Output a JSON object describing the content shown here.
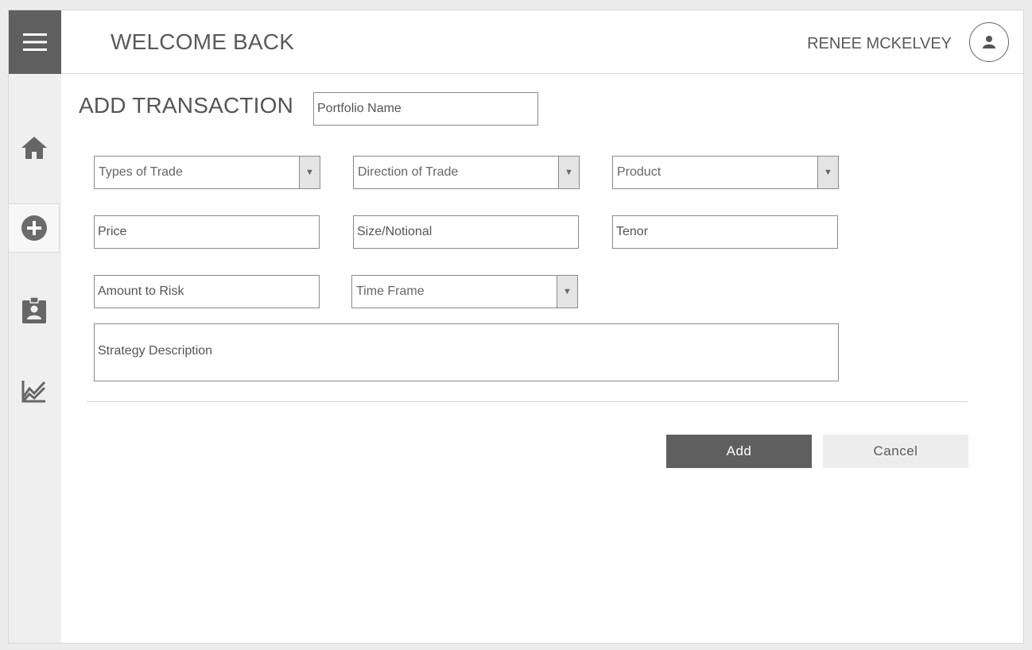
{
  "header": {
    "welcome": "WELCOME BACK",
    "username": "RENEE MCKELVEY"
  },
  "icons": {
    "menu": "hamburger-icon",
    "avatar": "user-icon",
    "nav": [
      "home-icon",
      "add-circle-icon",
      "badge-icon",
      "chart-icon"
    ]
  },
  "page": {
    "title": "ADD TRANSACTION",
    "portfolio_placeholder": "Portfolio Name"
  },
  "form": {
    "types_of_trade": "Types of Trade",
    "direction_of_trade": "Direction of Trade",
    "product": "Product",
    "price_placeholder": "Price",
    "size_placeholder": "Size/Notional",
    "tenor_placeholder": "Tenor",
    "amount_placeholder": "Amount to Risk",
    "time_frame": "Time Frame",
    "strategy_placeholder": "Strategy Description"
  },
  "actions": {
    "add": "Add",
    "cancel": "Cancel"
  },
  "colors": {
    "dark": "#5f5f5f",
    "sidebar": "#efefef",
    "cancel_bg": "#ededed",
    "icon": "#666666"
  }
}
